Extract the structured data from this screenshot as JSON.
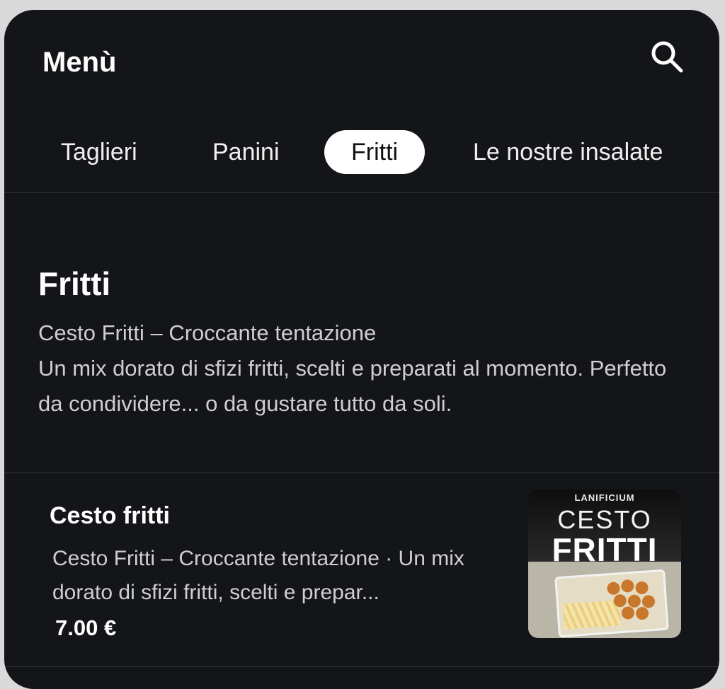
{
  "header": {
    "title": "Menù",
    "search_icon": "search-icon"
  },
  "tabs": [
    {
      "label": "Taglieri",
      "active": false
    },
    {
      "label": "Panini",
      "active": false
    },
    {
      "label": "Fritti",
      "active": true
    },
    {
      "label": "Le nostre insalate",
      "active": false
    }
  ],
  "section": {
    "title": "Fritti",
    "subtitle": "Cesto Fritti – Croccante tentazione",
    "description": "Un mix dorato di sfizi fritti, scelti e preparati al momento. Perfetto da condividere... o da gustare tutto da soli."
  },
  "items": [
    {
      "name": "Cesto fritti",
      "description": "Cesto Fritti – Croccante tentazione · Un mix dorato di sfizi fritti, scelti e prepar...",
      "price": "7.00 €",
      "image": {
        "brand": "LANIFICIUM",
        "line1": "CESTO",
        "line2": "FRITTI"
      }
    }
  ],
  "colors": {
    "background": "#141518",
    "active_tab_bg": "#ffffff",
    "text_primary": "#ffffff",
    "text_secondary": "#cfcfd2"
  }
}
